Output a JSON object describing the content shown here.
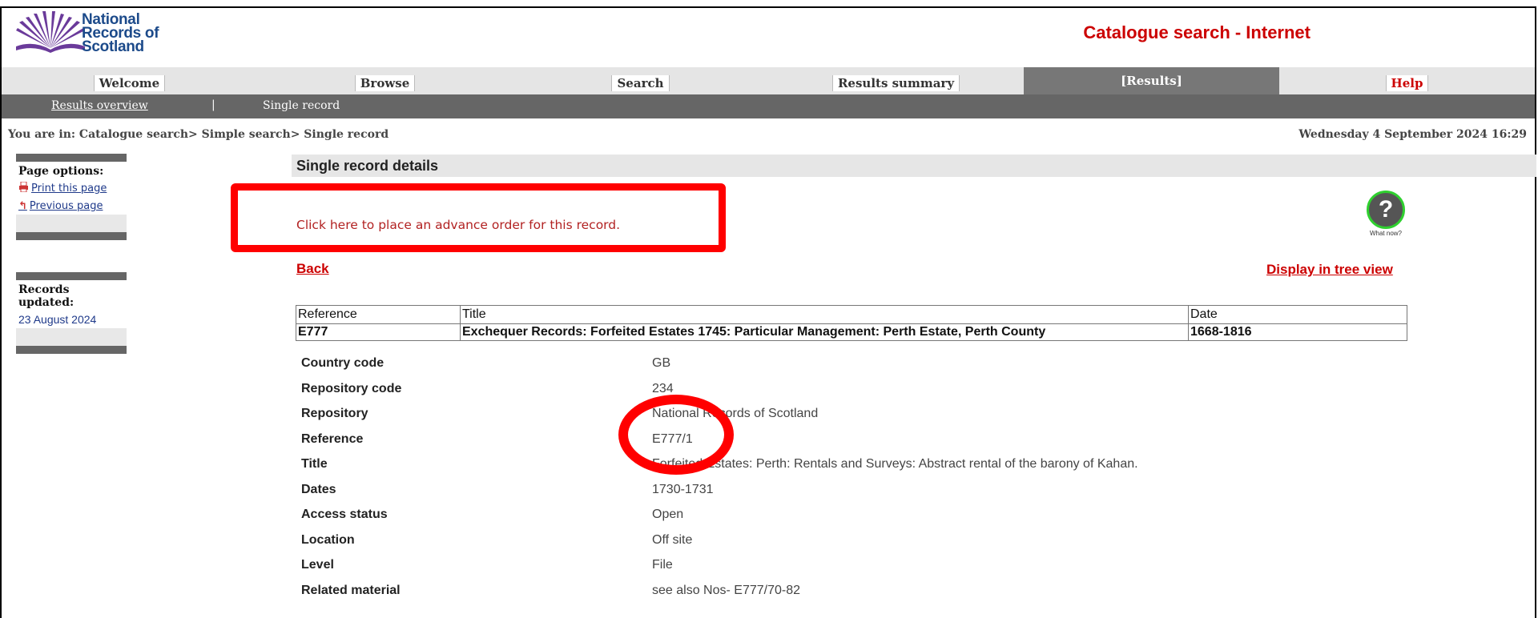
{
  "header": {
    "logo_lines": [
      "National",
      "Records of",
      "Scotland"
    ],
    "app_title": "Catalogue search - Internet"
  },
  "nav": {
    "tabs": [
      {
        "label": "Welcome"
      },
      {
        "label": "Browse"
      },
      {
        "label": "Search"
      },
      {
        "label": "Results summary"
      },
      {
        "label": "[Results]"
      },
      {
        "label": "Help"
      }
    ]
  },
  "subnav": {
    "results_overview": "Results overview",
    "separator": "|",
    "single_record": "Single record"
  },
  "breadcrumb": "You are in: Catalogue search> Simple search> Single record",
  "datetime": "Wednesday 4 September 2024 16:29",
  "sidebar": {
    "page_options_title": "Page options:",
    "print_label": "Print this page",
    "previous_label": "Previous page",
    "records_updated_title": "Records updated:",
    "records_updated_value": "23 August 2024"
  },
  "main": {
    "section_title": "Single record details",
    "order_link": "Click here to place an advance order for this record.",
    "help_caption": "What now?",
    "back_label": "Back",
    "tree_view_label": "Display in tree view",
    "summary_table": {
      "headers": [
        "Reference",
        "Title",
        "Date"
      ],
      "row": [
        "E777",
        "Exchequer Records: Forfeited Estates 1745: Particular Management: Perth Estate, Perth County",
        "1668-1816"
      ]
    },
    "details": [
      {
        "label": "Country code",
        "value": "GB"
      },
      {
        "label": "Repository code",
        "value": "234"
      },
      {
        "label": "Repository",
        "value": "National Records of Scotland"
      },
      {
        "label": "Reference",
        "value": "E777/1"
      },
      {
        "label": "Title",
        "value": "Forfeited Estates: Perth: Rentals and Surveys: Abstract rental of the barony of Kahan."
      },
      {
        "label": "Dates",
        "value": "1730-1731"
      },
      {
        "label": "Access status",
        "value": "Open"
      },
      {
        "label": "Location",
        "value": "Off site"
      },
      {
        "label": "Level",
        "value": "File"
      },
      {
        "label": "Related material",
        "value": "see also Nos- E777/70-82"
      }
    ]
  },
  "colors": {
    "accent_red": "#cc0000",
    "annotation_red": "#ff0000",
    "nav_active": "#777777",
    "subnav_bg": "#666666"
  }
}
